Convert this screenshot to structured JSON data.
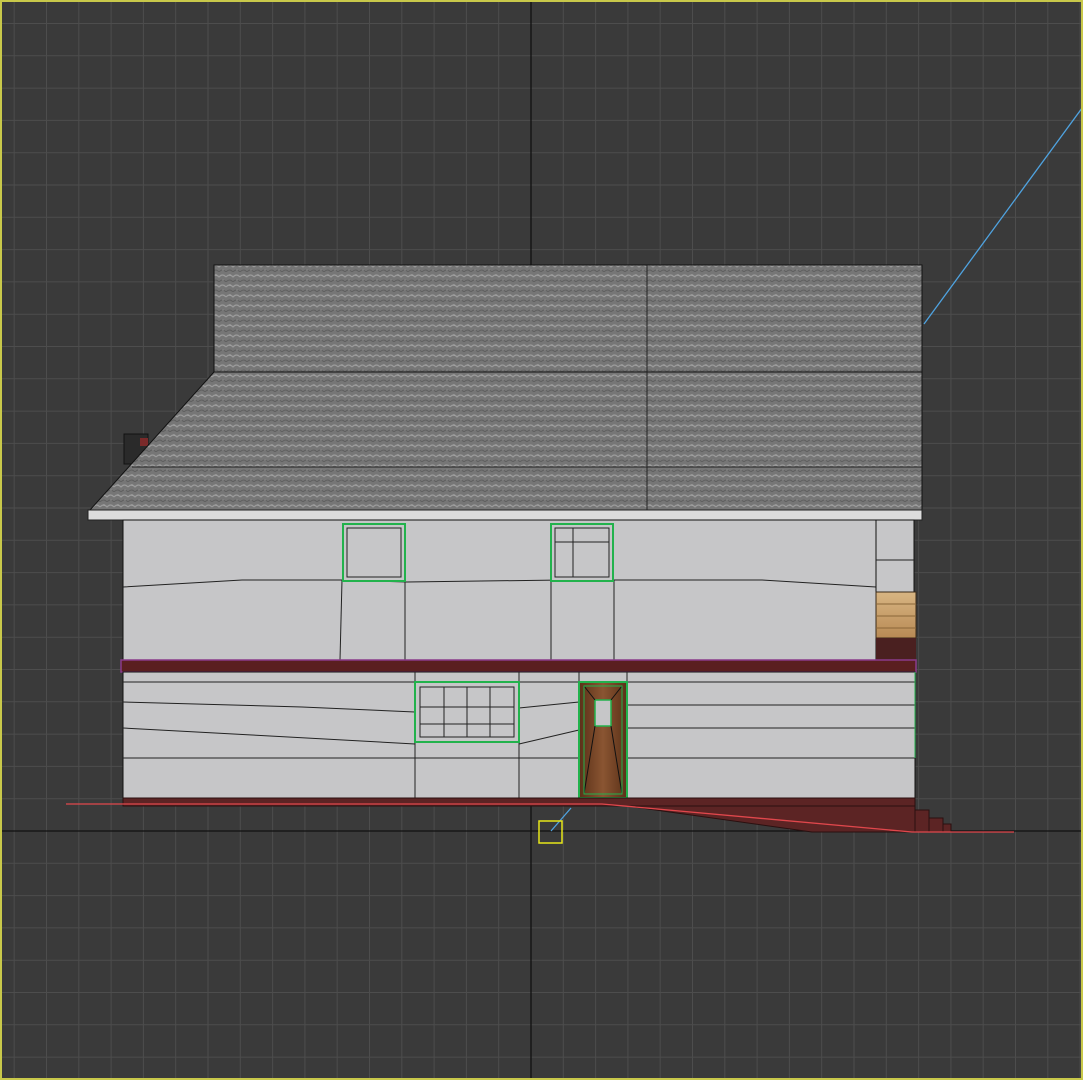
{
  "viewport": {
    "view": "front",
    "grid_visible": true,
    "active": true,
    "colors": {
      "background": "#3a3a3a",
      "grid_line": "#4d4d4d",
      "world_axis": "#111111",
      "active_border": "#c8c84a",
      "selection_highlight": "#22b24c",
      "selected_trim": "#8a3a8a",
      "ground_line": "#e0474c",
      "camera_target_line": "#4fa3e0",
      "pivot_marker": "#e6e619"
    }
  },
  "scene": {
    "objects": [
      {
        "id": "roof",
        "material": "asphalt-shingle",
        "color": "#7a7a7a"
      },
      {
        "id": "upper-siding",
        "material": "vinyl-siding",
        "color": "#c6c6c8"
      },
      {
        "id": "band-trim",
        "material": "painted-wood",
        "color": "#5a1f20",
        "selected": true
      },
      {
        "id": "lower-siding",
        "material": "vinyl-siding",
        "color": "#c6c6c8"
      },
      {
        "id": "foundation",
        "material": "brick",
        "color": "#5c2424"
      },
      {
        "id": "front-door",
        "material": "wood",
        "color": "#6a3a22",
        "selected": true
      },
      {
        "id": "window-upper-left",
        "material": "glass",
        "selected": true
      },
      {
        "id": "window-upper-right",
        "material": "glass",
        "selected": true
      },
      {
        "id": "window-lower",
        "material": "glass",
        "selected": true
      },
      {
        "id": "side-stair",
        "material": "wood",
        "color": "#c9a070"
      }
    ]
  }
}
